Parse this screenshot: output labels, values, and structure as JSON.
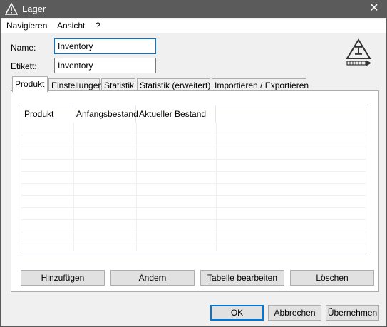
{
  "window": {
    "title": "Lager",
    "close_glyph": "✕",
    "icon": "warning-triangle-icon"
  },
  "menu": {
    "items": [
      "Navigieren",
      "Ansicht",
      "?"
    ]
  },
  "form": {
    "name_label": "Name:",
    "name_value": "Inventory",
    "etikett_label": "Etikett:",
    "etikett_value": "Inventory"
  },
  "tabs": [
    "Produkt",
    "Einstellungen",
    "Statistik",
    "Statistik (erweitert)",
    "Importieren / Exportieren"
  ],
  "active_tab": "Produkt",
  "table": {
    "columns": [
      "Produkt",
      "Anfangsbestand",
      "Aktueller Bestand"
    ],
    "rows": []
  },
  "panel_buttons": [
    "Hinzufügen",
    "Ändern",
    "Tabelle bearbeiten",
    "Löschen"
  ],
  "dialog_buttons": {
    "ok": "OK",
    "cancel": "Abbrechen",
    "apply": "Übernehmen"
  },
  "colors": {
    "titlebar": "#5b5b5b",
    "focus": "#0078d7",
    "button_face": "#e1e1e1"
  }
}
